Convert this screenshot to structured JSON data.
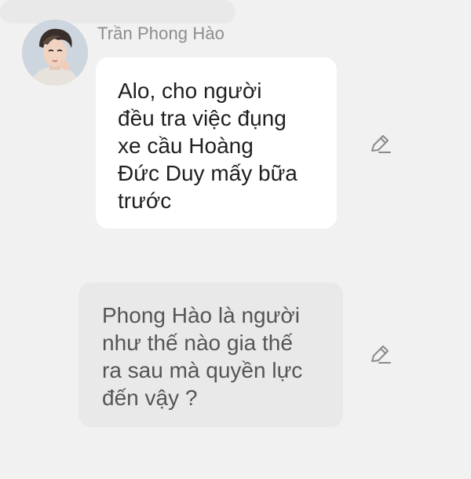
{
  "conversation": {
    "sender_name": "Trần Phong Hào",
    "messages": [
      {
        "text": "Alo, cho người\nđều tra việc đụng\nxe cầu Hoàng\nĐức Duy mấy bữa\ntrước",
        "style": "incoming"
      },
      {
        "text": "Phong Hào là người\nnhư thế nào gia thế\nra sau mà quyền lực\nđến vậy ?",
        "style": "quoted"
      }
    ]
  },
  "icons": {
    "avatar": "avatar-photo",
    "edit": "pencil-icon"
  },
  "colors": {
    "background": "#f1f1f1",
    "incoming_bubble": "#ffffff",
    "quoted_bubble": "#e9e9e9",
    "name_text": "#8d8d8d",
    "icon": "#8a8a8a"
  }
}
